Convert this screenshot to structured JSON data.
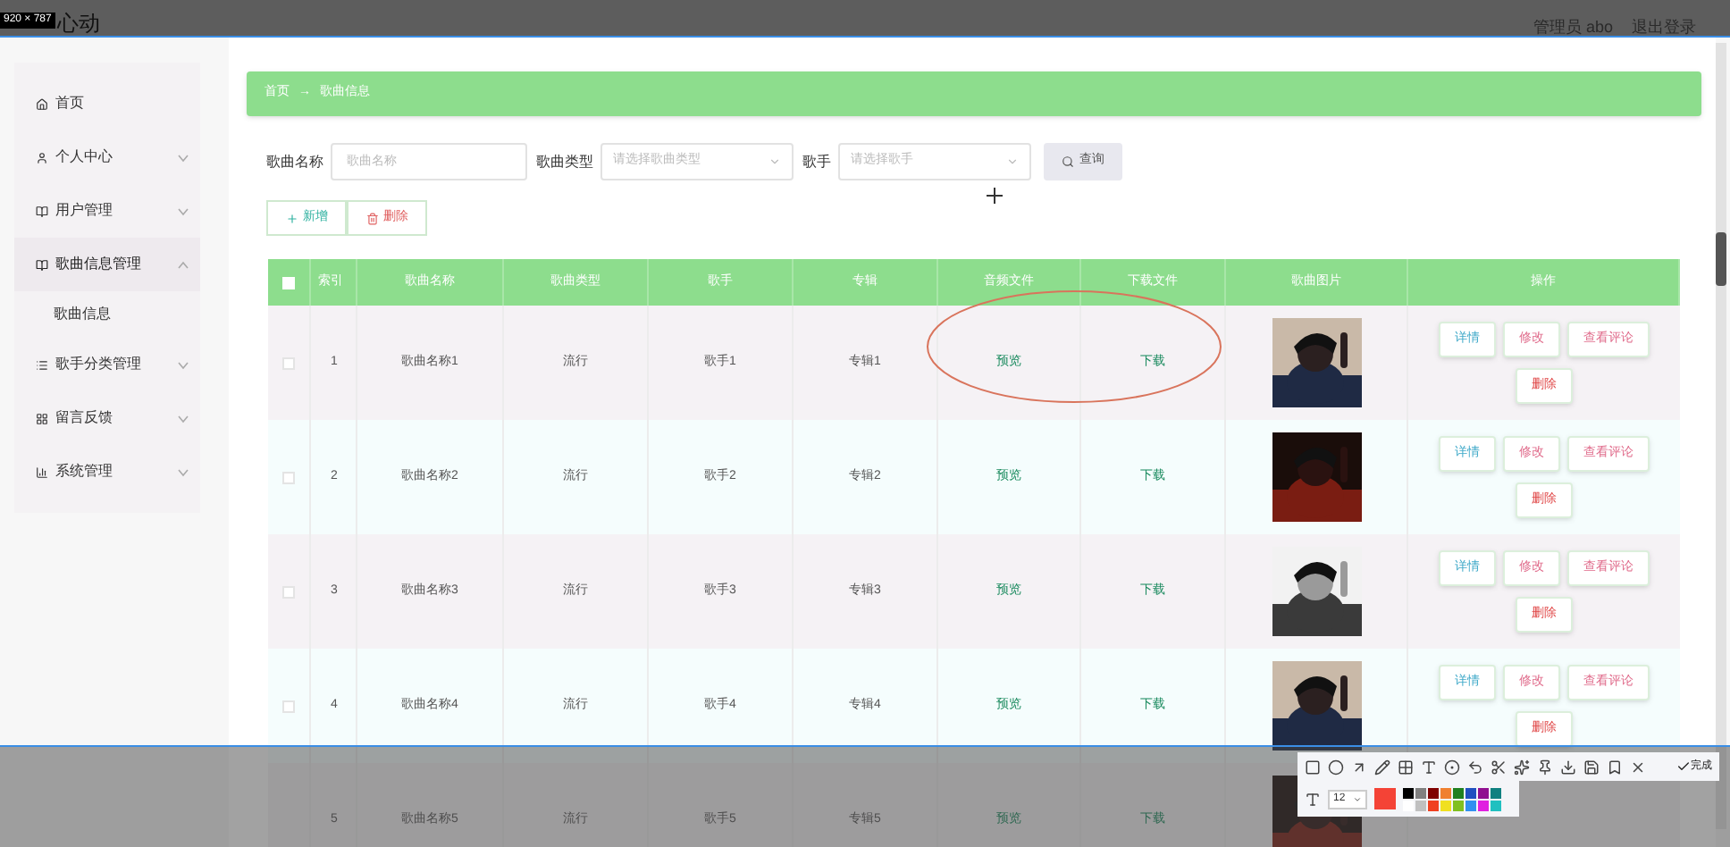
{
  "capture": {
    "size_label": "920 × 787"
  },
  "header": {
    "title": "心动",
    "user": "管理员 abo",
    "logout": "退出登录"
  },
  "sidebar": {
    "items": [
      {
        "label": "首页"
      },
      {
        "label": "个人中心",
        "expanded": false
      },
      {
        "label": "用户管理",
        "expanded": false
      },
      {
        "label": "歌曲信息管理",
        "expanded": true,
        "children": [
          {
            "label": "歌曲信息"
          }
        ]
      },
      {
        "label": "歌手分类管理",
        "expanded": false
      },
      {
        "label": "留言反馈",
        "expanded": false
      },
      {
        "label": "系统管理",
        "expanded": false
      }
    ]
  },
  "breadcrumb": [
    "首页",
    "→",
    "歌曲信息"
  ],
  "search": {
    "fields": [
      {
        "kind": "input",
        "label": "歌曲名称",
        "placeholder": "歌曲名称"
      },
      {
        "kind": "select",
        "label": "歌曲类型",
        "placeholder": "请选择歌曲类型"
      },
      {
        "kind": "select",
        "label": "歌手",
        "placeholder": "请选择歌手"
      }
    ],
    "button": "查询"
  },
  "actions": [
    {
      "kind": "add",
      "label": "新增"
    },
    {
      "kind": "delete",
      "label": "删除"
    }
  ],
  "table": {
    "all_checked": false,
    "columns": [
      "索引",
      "歌曲名称",
      "歌曲类型",
      "歌手",
      "专辑",
      "音频文件",
      "下载文件",
      "歌曲图片",
      "操作"
    ],
    "rows": [
      {
        "checked": false,
        "cells": [
          "1",
          "歌曲名称1",
          "流行",
          "歌手1",
          "专辑1"
        ],
        "audio": "预览",
        "download": "下载",
        "image": {
          "kind": "picture"
        },
        "buttons": [
          {
            "label": "详情",
            "color": "#3fa9c9"
          },
          {
            "label": "修改",
            "color": "#e06b8b"
          },
          {
            "label": "查看评论",
            "color": "#e06b8b"
          },
          {
            "label": "删除",
            "color": "#e04848"
          }
        ]
      },
      {
        "checked": false,
        "cells": [
          "2",
          "歌曲名称2",
          "流行",
          "歌手2",
          "专辑2"
        ],
        "audio": "预览",
        "download": "下载",
        "image": {
          "kind": "picture"
        },
        "buttons": [
          {
            "label": "详情",
            "color": "#3fa9c9"
          },
          {
            "label": "修改",
            "color": "#e06b8b"
          },
          {
            "label": "查看评论",
            "color": "#e06b8b"
          },
          {
            "label": "删除",
            "color": "#e04848"
          }
        ]
      },
      {
        "checked": false,
        "cells": [
          "3",
          "歌曲名称3",
          "流行",
          "歌手3",
          "专辑3"
        ],
        "audio": "预览",
        "download": "下载",
        "image": {
          "kind": "picture"
        },
        "buttons": [
          {
            "label": "详情",
            "color": "#3fa9c9"
          },
          {
            "label": "修改",
            "color": "#e06b8b"
          },
          {
            "label": "查看评论",
            "color": "#e06b8b"
          },
          {
            "label": "删除",
            "color": "#e04848"
          }
        ]
      },
      {
        "checked": false,
        "cells": [
          "4",
          "歌曲名称4",
          "流行",
          "歌手4",
          "专辑4"
        ],
        "audio": "预览",
        "download": "下载",
        "image": {
          "kind": "picture"
        },
        "buttons": [
          {
            "label": "详情",
            "color": "#3fa9c9"
          },
          {
            "label": "修改",
            "color": "#e06b8b"
          },
          {
            "label": "查看评论",
            "color": "#e06b8b"
          },
          {
            "label": "删除",
            "color": "#e04848"
          }
        ]
      },
      {
        "cells": [
          "5",
          "歌曲名称5",
          "流行",
          "歌手5",
          "专辑5"
        ],
        "audio": "预览",
        "download": "下载",
        "image": {
          "kind": "picture"
        }
      }
    ]
  },
  "capture_toolbar": {
    "done": "完成",
    "font_size": "12",
    "current_swatch": {
      "color": "#f44336"
    },
    "palette": [
      {
        "color": "#000000"
      },
      {
        "color": "#808080"
      },
      {
        "color": "#800000"
      },
      {
        "color": "#f08030"
      },
      {
        "color": "#208020"
      },
      {
        "color": "#2050c0"
      },
      {
        "color": "#901090"
      },
      {
        "color": "#108080"
      },
      {
        "color": "#ffffff"
      },
      {
        "color": "#c0c0c0"
      },
      {
        "color": "#f04020"
      },
      {
        "color": "#f0e020"
      },
      {
        "color": "#80c020"
      },
      {
        "color": "#3090f0"
      },
      {
        "color": "#e020e0"
      },
      {
        "color": "#20c0c0"
      }
    ]
  }
}
